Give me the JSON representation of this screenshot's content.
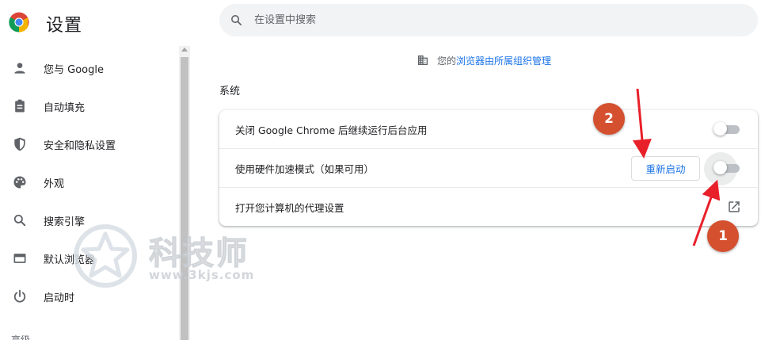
{
  "app": {
    "title": "设置"
  },
  "search": {
    "placeholder": "在设置中搜索"
  },
  "sidebar": {
    "items": [
      {
        "label": "您与 Google",
        "icon": "person-icon"
      },
      {
        "label": "自动填充",
        "icon": "clipboard-icon"
      },
      {
        "label": "安全和隐私设置",
        "icon": "shield-icon"
      },
      {
        "label": "外观",
        "icon": "palette-icon"
      },
      {
        "label": "搜索引擎",
        "icon": "search-icon"
      },
      {
        "label": "默认浏览器",
        "icon": "browser-icon"
      },
      {
        "label": "启动时",
        "icon": "power-icon"
      }
    ],
    "more_label": "高级"
  },
  "managed": {
    "prefix": "您的",
    "link": "浏览器由所属组织管理"
  },
  "section": {
    "title": "系统"
  },
  "system": {
    "rows": [
      {
        "label": "关闭 Google Chrome 后继续运行后台应用",
        "toggle_on": false
      },
      {
        "label": "使用硬件加速模式（如果可用）",
        "toggle_on": false,
        "button": "重新启动"
      },
      {
        "label": "打开您计算机的代理设置"
      }
    ]
  },
  "annotations": {
    "marker1": "1",
    "marker2": "2"
  },
  "watermark": {
    "title": "科技师",
    "url": "www.3kjs.com"
  },
  "colors": {
    "accent": "#1a73e8",
    "marker": "#d4502f",
    "arrow": "#e8202a"
  }
}
